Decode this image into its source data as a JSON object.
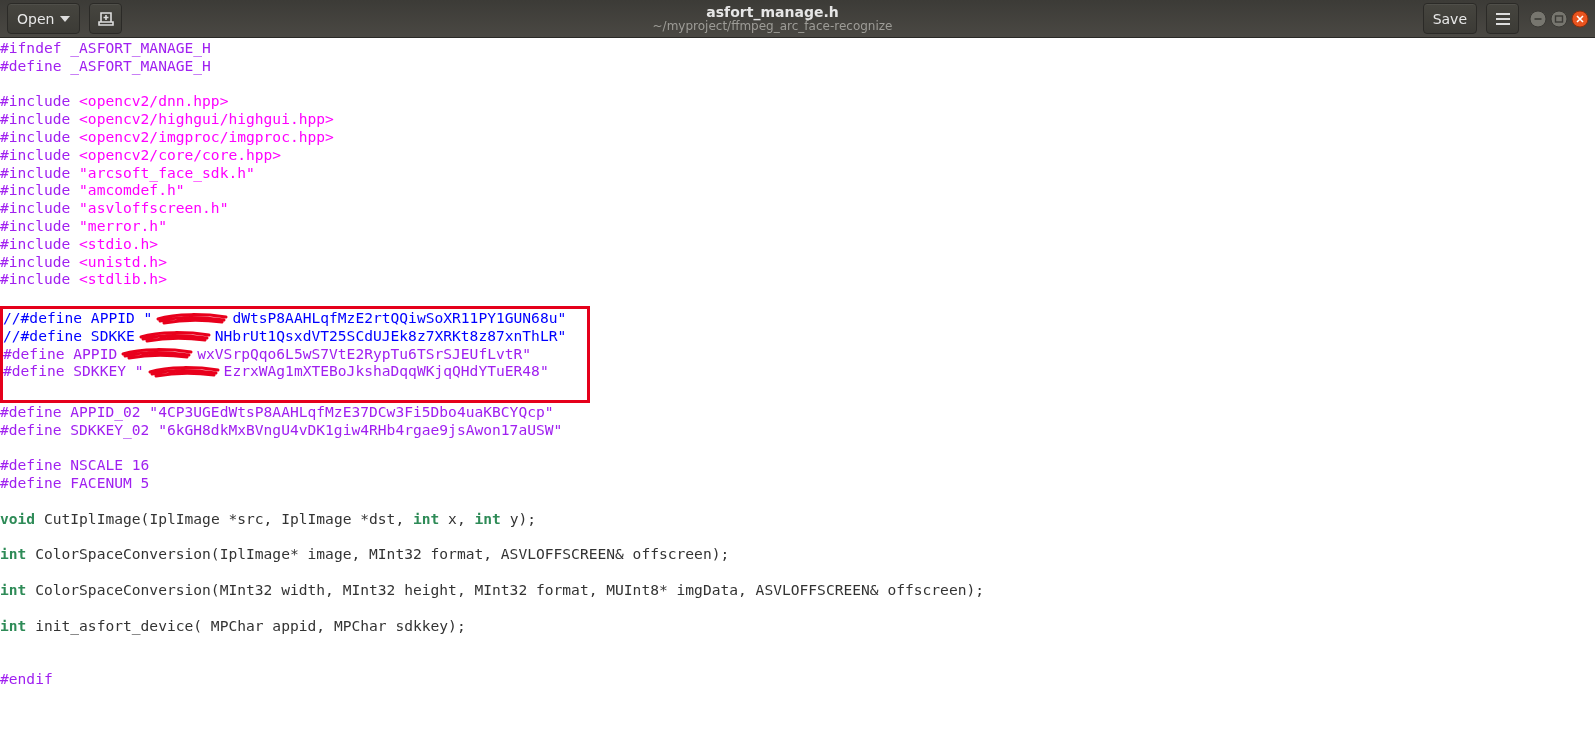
{
  "header": {
    "open_button": "Open",
    "title": "asfort_manage.h",
    "subtitle": "~/myproject/ffmpeg_arc_face-recognize",
    "save_button": "Save"
  },
  "editor": {
    "lines": [
      {
        "kind": "code",
        "segments": [
          {
            "kind": "preproc",
            "text": "#ifndef _ASFORT_MANAGE_H"
          }
        ]
      },
      {
        "kind": "code",
        "segments": [
          {
            "kind": "preproc",
            "text": "#define _ASFORT_MANAGE_H"
          }
        ]
      },
      {
        "kind": "blank"
      },
      {
        "kind": "code",
        "segments": [
          {
            "kind": "preproc",
            "text": "#include "
          },
          {
            "kind": "string",
            "text": "<opencv2/dnn.hpp>"
          }
        ]
      },
      {
        "kind": "code",
        "segments": [
          {
            "kind": "preproc",
            "text": "#include "
          },
          {
            "kind": "string",
            "text": "<opencv2/highgui/highgui.hpp>"
          }
        ]
      },
      {
        "kind": "code",
        "segments": [
          {
            "kind": "preproc",
            "text": "#include "
          },
          {
            "kind": "string",
            "text": "<opencv2/imgproc/imgproc.hpp>"
          }
        ]
      },
      {
        "kind": "code",
        "segments": [
          {
            "kind": "preproc",
            "text": "#include "
          },
          {
            "kind": "string",
            "text": "<opencv2/core/core.hpp>"
          }
        ]
      },
      {
        "kind": "code",
        "segments": [
          {
            "kind": "preproc",
            "text": "#include "
          },
          {
            "kind": "string",
            "text": "\"arcsoft_face_sdk.h\""
          }
        ]
      },
      {
        "kind": "code",
        "segments": [
          {
            "kind": "preproc",
            "text": "#include "
          },
          {
            "kind": "string",
            "text": "\"amcomdef.h\""
          }
        ]
      },
      {
        "kind": "code",
        "segments": [
          {
            "kind": "preproc",
            "text": "#include "
          },
          {
            "kind": "string",
            "text": "\"asvloffscreen.h\""
          }
        ]
      },
      {
        "kind": "code",
        "segments": [
          {
            "kind": "preproc",
            "text": "#include "
          },
          {
            "kind": "string",
            "text": "\"merror.h\""
          }
        ]
      },
      {
        "kind": "code",
        "segments": [
          {
            "kind": "preproc",
            "text": "#include "
          },
          {
            "kind": "string",
            "text": "<stdio.h>"
          }
        ]
      },
      {
        "kind": "code",
        "segments": [
          {
            "kind": "preproc",
            "text": "#include "
          },
          {
            "kind": "string",
            "text": "<unistd.h>"
          }
        ]
      },
      {
        "kind": "code",
        "segments": [
          {
            "kind": "preproc",
            "text": "#include "
          },
          {
            "kind": "string",
            "text": "<stdlib.h>"
          }
        ]
      },
      {
        "kind": "blank"
      },
      {
        "kind": "highlight",
        "lines": [
          {
            "kind": "redacted",
            "segments": [
              {
                "kind": "comment",
                "text": "//#define APPID \""
              },
              {
                "kind": "comment",
                "text": "dWtsP8AAHLqfMzE2rtQQiwSoXR11PY1GUN68u\""
              }
            ]
          },
          {
            "kind": "redacted",
            "segments": [
              {
                "kind": "comment",
                "text": "//#define SDKKE"
              },
              {
                "kind": "comment",
                "text": "NHbrUt1QsxdVT25SCdUJEk8z7XRKt8z87xnThLR\""
              }
            ]
          },
          {
            "kind": "redacted",
            "segments": [
              {
                "kind": "preproc",
                "text": "#define APPID"
              },
              {
                "kind": "preproc",
                "text": "wxVSrpQqo6L5wS7VtE2RypTu6TSrSJEUfLvtR\""
              }
            ]
          },
          {
            "kind": "redacted",
            "segments": [
              {
                "kind": "preproc",
                "text": "#define SDKKEY \""
              },
              {
                "kind": "preproc",
                "text": "EzrxWAg1mXTEBoJkshaDqqWKjqQHdYTuER48\""
              }
            ]
          },
          {
            "kind": "blank"
          }
        ]
      },
      {
        "kind": "code",
        "segments": [
          {
            "kind": "preproc",
            "text": "#define APPID_02 \"4CP3UGEdWtsP8AAHLqfMzE37DCw3Fi5Dbo4uaKBCYQcp\""
          }
        ]
      },
      {
        "kind": "code",
        "segments": [
          {
            "kind": "preproc",
            "text": "#define SDKKEY_02 \"6kGH8dkMxBVngU4vDK1giw4RHb4rgae9jsAwon17aUSW\""
          }
        ]
      },
      {
        "kind": "blank"
      },
      {
        "kind": "code",
        "segments": [
          {
            "kind": "preproc",
            "text": "#define NSCALE 16"
          }
        ]
      },
      {
        "kind": "code",
        "segments": [
          {
            "kind": "preproc",
            "text": "#define FACENUM 5"
          }
        ]
      },
      {
        "kind": "blank"
      },
      {
        "kind": "code",
        "segments": [
          {
            "kind": "keyword",
            "text": "void"
          },
          {
            "kind": "plain",
            "text": " CutIplImage(IplImage *src, IplImage *dst, "
          },
          {
            "kind": "keyword",
            "text": "int"
          },
          {
            "kind": "plain",
            "text": " x, "
          },
          {
            "kind": "keyword",
            "text": "int"
          },
          {
            "kind": "plain",
            "text": " y);"
          }
        ]
      },
      {
        "kind": "blank"
      },
      {
        "kind": "code",
        "segments": [
          {
            "kind": "keyword",
            "text": "int"
          },
          {
            "kind": "plain",
            "text": " ColorSpaceConversion(IplImage* image, MInt32 format, ASVLOFFSCREEN& offscreen);"
          }
        ]
      },
      {
        "kind": "blank"
      },
      {
        "kind": "code",
        "segments": [
          {
            "kind": "keyword",
            "text": "int"
          },
          {
            "kind": "plain",
            "text": " ColorSpaceConversion(MInt32 width, MInt32 height, MInt32 format, MUInt8* imgData, ASVLOFFSCREEN& offscreen);"
          }
        ]
      },
      {
        "kind": "blank"
      },
      {
        "kind": "code",
        "segments": [
          {
            "kind": "keyword",
            "text": "int"
          },
          {
            "kind": "plain",
            "text": " init_asfort_device( MPChar appid, MPChar sdkkey);"
          }
        ]
      },
      {
        "kind": "blank"
      },
      {
        "kind": "blank"
      },
      {
        "kind": "code",
        "segments": [
          {
            "kind": "preproc",
            "text": "#endif"
          }
        ]
      }
    ]
  }
}
